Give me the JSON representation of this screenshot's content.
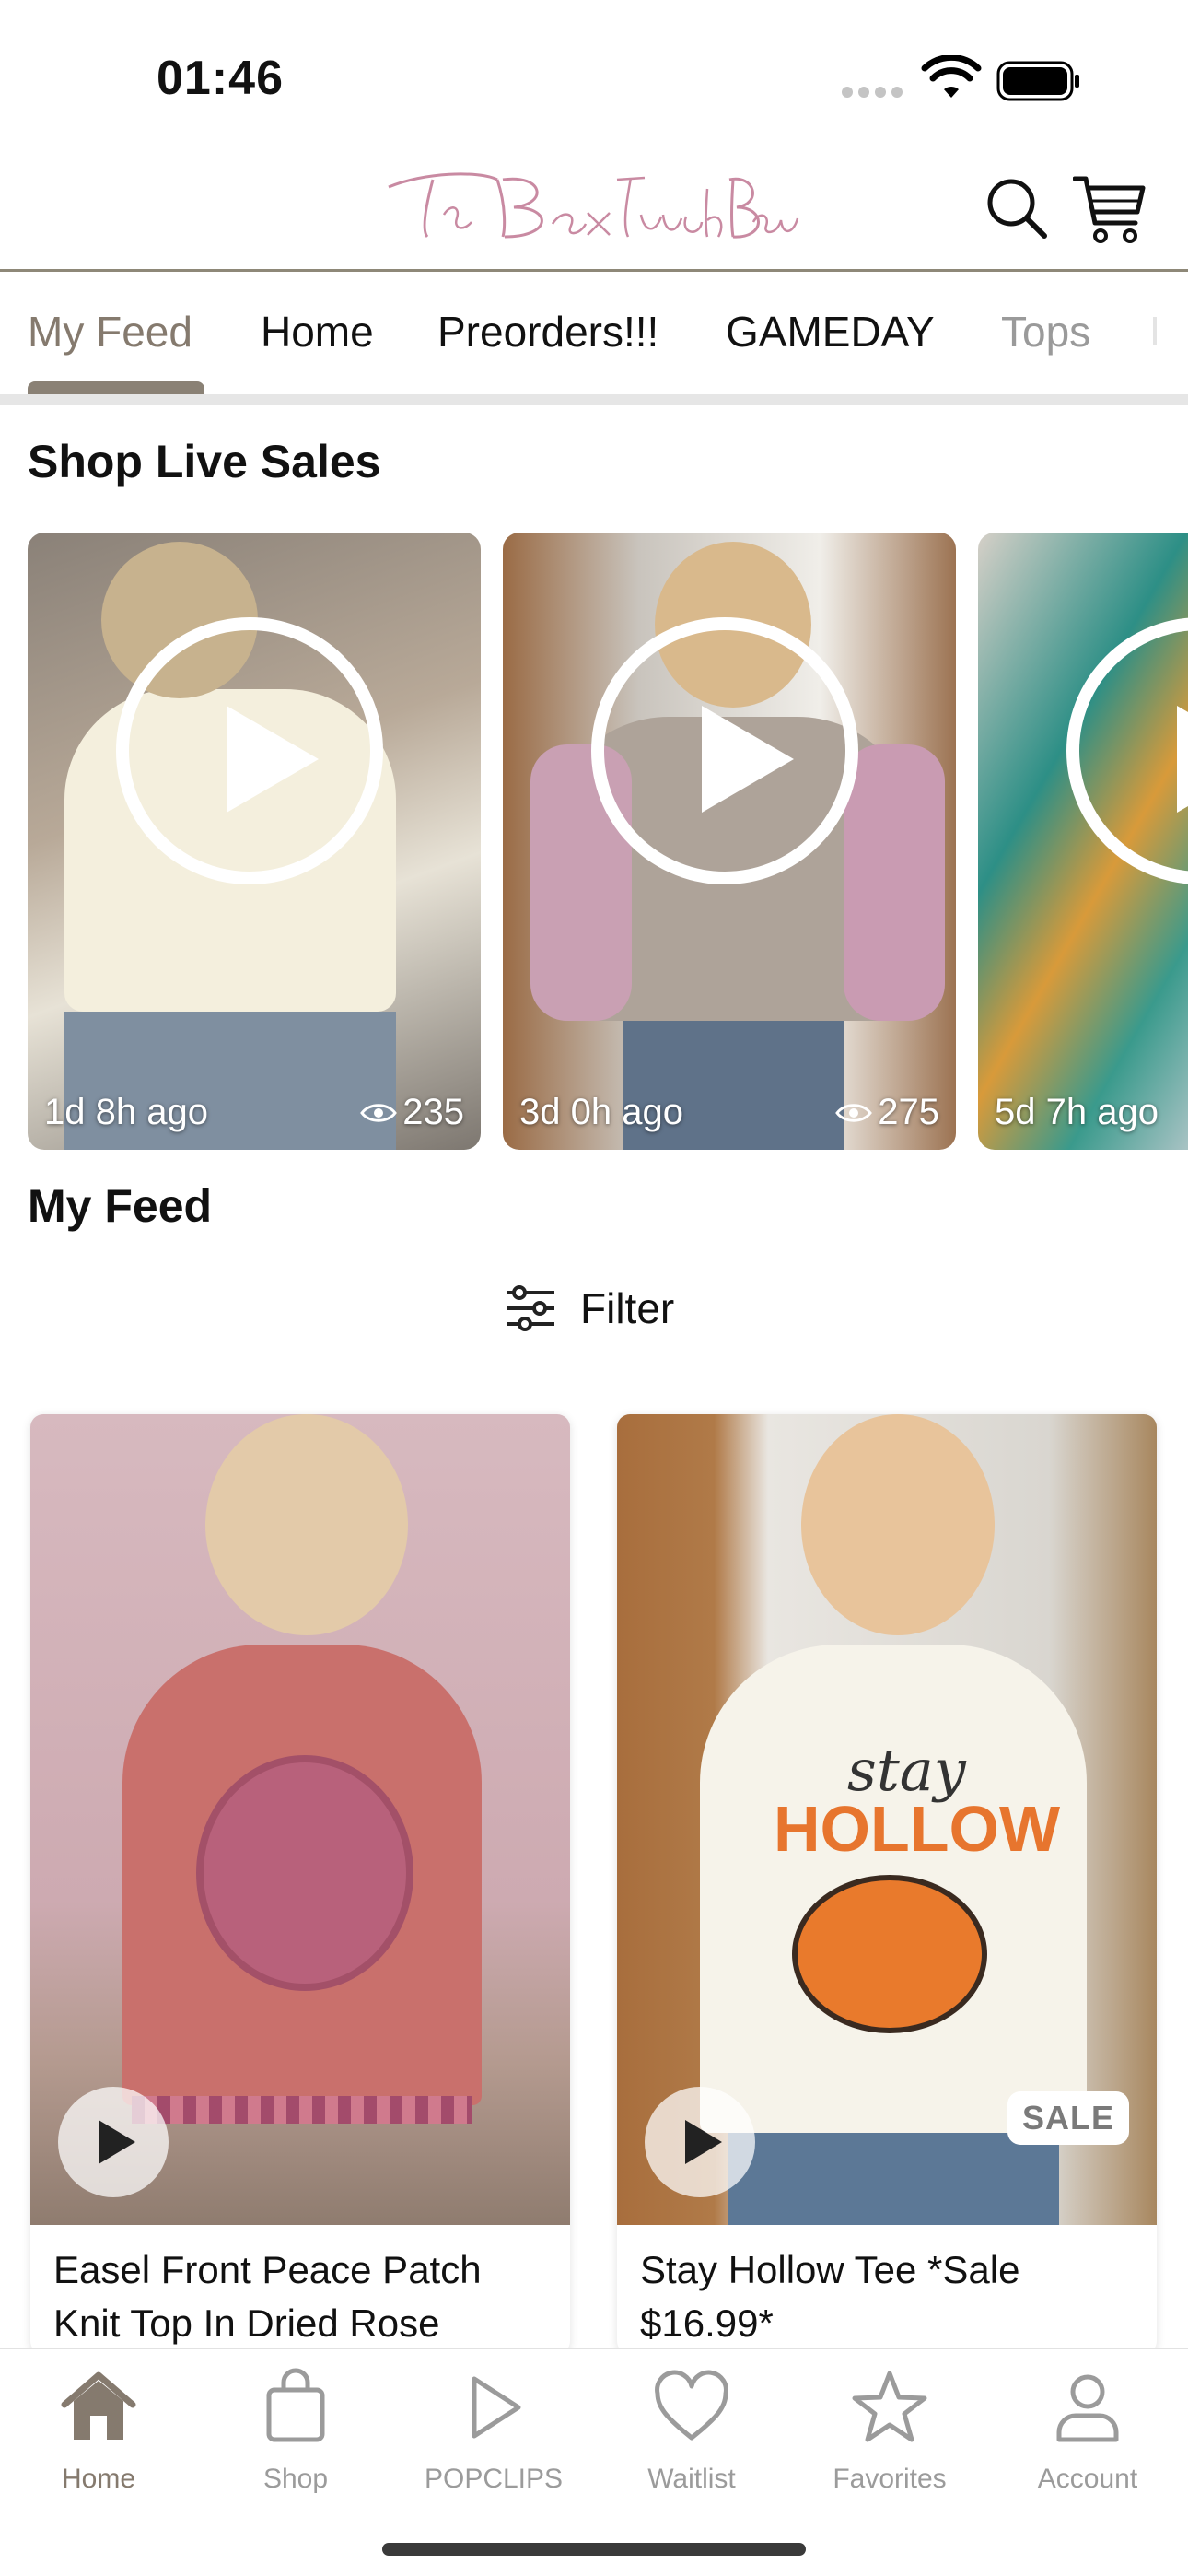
{
  "status_bar": {
    "time": "01:46"
  },
  "header": {
    "logo_text": "The BoxTruck Boutique"
  },
  "tabs": [
    {
      "label": "My Feed",
      "active": true
    },
    {
      "label": "Home"
    },
    {
      "label": "Preorders!!!"
    },
    {
      "label": "GAMEDAY"
    },
    {
      "label": "Tops"
    }
  ],
  "live_sales": {
    "title": "Shop Live Sales",
    "items": [
      {
        "ago": "1d 8h ago",
        "views": "235"
      },
      {
        "ago": "3d 0h ago",
        "views": "275"
      },
      {
        "ago": "5d 7h ago"
      }
    ]
  },
  "feed": {
    "title": "My Feed",
    "filter_label": "Filter",
    "products": [
      {
        "name": "Easel Front Peace Patch Knit Top In Dried Rose"
      },
      {
        "name": "Stay Hollow Tee *Sale $16.99*",
        "badge": "SALE",
        "shirt_text_1": "stay",
        "shirt_text_2": "HOLLOW"
      }
    ]
  },
  "bottom_nav": [
    {
      "label": "Home",
      "icon": "home-icon",
      "active": true
    },
    {
      "label": "Shop",
      "icon": "shopping-bag-icon"
    },
    {
      "label": "POPCLIPS",
      "icon": "play-icon"
    },
    {
      "label": "Waitlist",
      "icon": "heart-icon"
    },
    {
      "label": "Favorites",
      "icon": "star-icon"
    },
    {
      "label": "Account",
      "icon": "user-icon"
    }
  ],
  "colors": {
    "accent": "#857a6e",
    "logo": "#c98aa2",
    "inactive_nav": "#9b9b9b"
  }
}
